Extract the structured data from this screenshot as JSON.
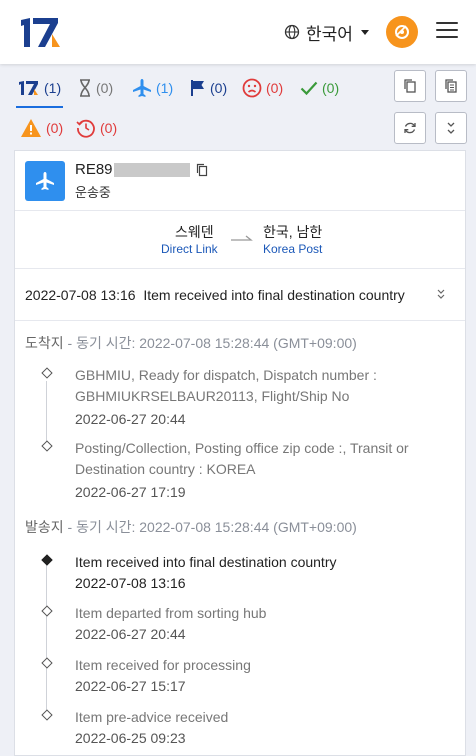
{
  "header": {
    "language_label": "한국어"
  },
  "filters": [
    {
      "key": "all",
      "count": "(1)",
      "color": "#1b3f8f"
    },
    {
      "key": "not-found",
      "count": "(0)",
      "color": "#777777"
    },
    {
      "key": "in-transit",
      "count": "(1)",
      "color": "#2f8fee"
    },
    {
      "key": "pickup",
      "count": "(0)",
      "color": "#1b3f8f"
    },
    {
      "key": "undelivered",
      "count": "(0)",
      "color": "#e03b3b"
    },
    {
      "key": "delivered",
      "count": "(0)",
      "color": "#3a9a3a"
    },
    {
      "key": "alert",
      "count": "(0)",
      "color": "#e03b3b"
    },
    {
      "key": "expired",
      "count": "(0)",
      "color": "#e03b3b"
    }
  ],
  "package": {
    "tracking_prefix": "RE89",
    "status": "운송중",
    "origin_country": "스웨덴",
    "origin_carrier": "Direct Link",
    "destination_country": "한국, 남한",
    "destination_carrier": "Korea Post",
    "latest_event": "2022-07-08 13:16  Item received into final destination country"
  },
  "destination_section": {
    "label": "도착지",
    "sync_text": "- 동기 시간: 2022-07-08 15:28:44 (GMT+09:00)",
    "events": [
      {
        "desc": "GBHMIU, Ready for dispatch, Dispatch number : GBHMIUKRSELBAUR20113, Flight/Ship No",
        "time": "2022-06-27 20:44"
      },
      {
        "desc": "Posting/Collection, Posting office zip code :, Transit or Destination country : KOREA",
        "time": "2022-06-27 17:19"
      }
    ]
  },
  "origin_section": {
    "label": "발송지",
    "sync_text": "- 동기 시간: 2022-07-08 15:28:44 (GMT+09:00)",
    "events": [
      {
        "desc": "Item received into final destination country",
        "time": "2022-07-08 13:16"
      },
      {
        "desc": "Item departed from sorting hub",
        "time": "2022-06-27 20:44"
      },
      {
        "desc": "Item received for processing",
        "time": "2022-06-27 15:17"
      },
      {
        "desc": "Item pre-advice received",
        "time": "2022-06-25 09:23"
      }
    ]
  }
}
